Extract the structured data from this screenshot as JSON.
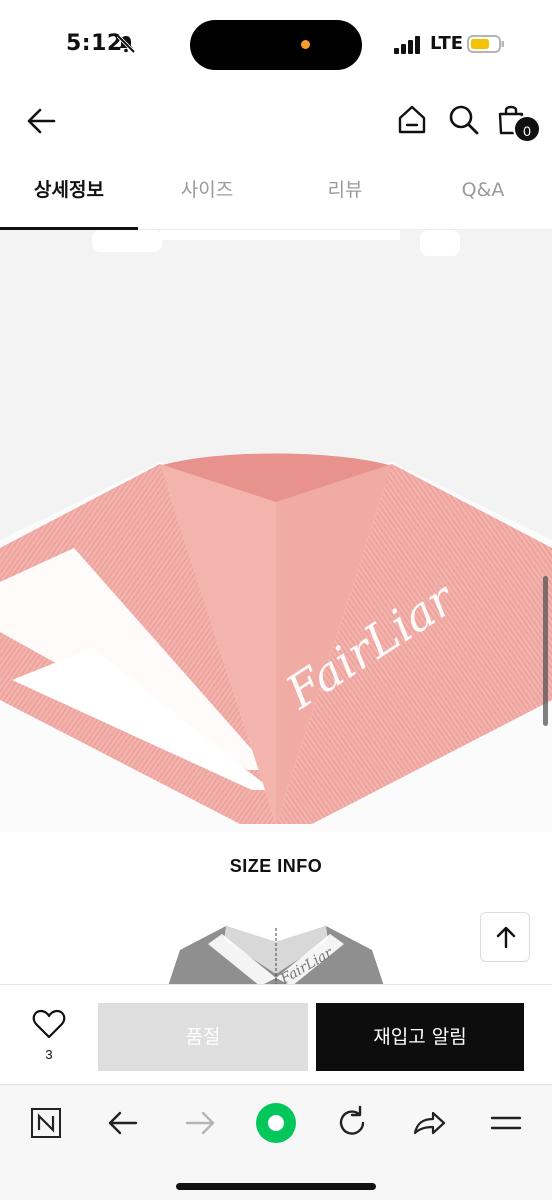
{
  "status_bar": {
    "time": "5:12",
    "network": "LTE",
    "icons": [
      "bell-slash-icon",
      "signal-icon",
      "battery-icon"
    ],
    "battery_color": "#f5c400"
  },
  "header": {
    "icons": [
      "back-arrow-icon",
      "home-icon",
      "search-icon",
      "shopping-bag-icon"
    ],
    "cart_count": "0"
  },
  "tabs": [
    {
      "label": "상세정보",
      "active": true
    },
    {
      "label": "사이즈",
      "active": false
    },
    {
      "label": "리뷰",
      "active": false
    },
    {
      "label": "Q&A",
      "active": false
    }
  ],
  "product_image": {
    "collar_color": "#f4b2ad",
    "logo_text": "FairLiar"
  },
  "size_info": {
    "title": "SIZE INFO",
    "preview_logo": "FairLiar"
  },
  "purchase_bar": {
    "wish_count": "3",
    "soldout_label": "품절",
    "restock_label": "재입고 알림"
  },
  "browser_bar": {
    "icons": [
      "naver-n-icon",
      "back-icon",
      "forward-icon",
      "green-circle-icon",
      "reload-icon",
      "share-icon",
      "menu-icon"
    ],
    "accent": "#03c75a"
  }
}
